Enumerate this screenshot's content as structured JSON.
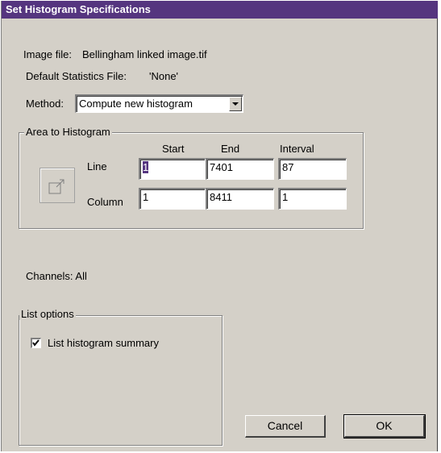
{
  "dialog": {
    "title": "Set Histogram Specifications",
    "image_file_label": "Image file:",
    "image_file_value": "Bellingham linked image.tif",
    "stats_file_label": "Default Statistics File:",
    "stats_file_value": "'None'",
    "method_label": "Method:",
    "method_value": "Compute new histogram",
    "area_group": {
      "label": "Area to Histogram",
      "headers": [
        "Start",
        "End",
        "Interval"
      ],
      "line_label": "Line",
      "column_label": "Column",
      "line_values": [
        "1",
        "7401",
        "87"
      ],
      "column_values": [
        "1",
        "8411",
        "1"
      ]
    },
    "channels_text": "Channels: All",
    "list_options": {
      "label": "List options",
      "summary_label": "List histogram summary",
      "summary_checked": true
    },
    "cancel_label": "Cancel",
    "ok_label": "OK"
  }
}
